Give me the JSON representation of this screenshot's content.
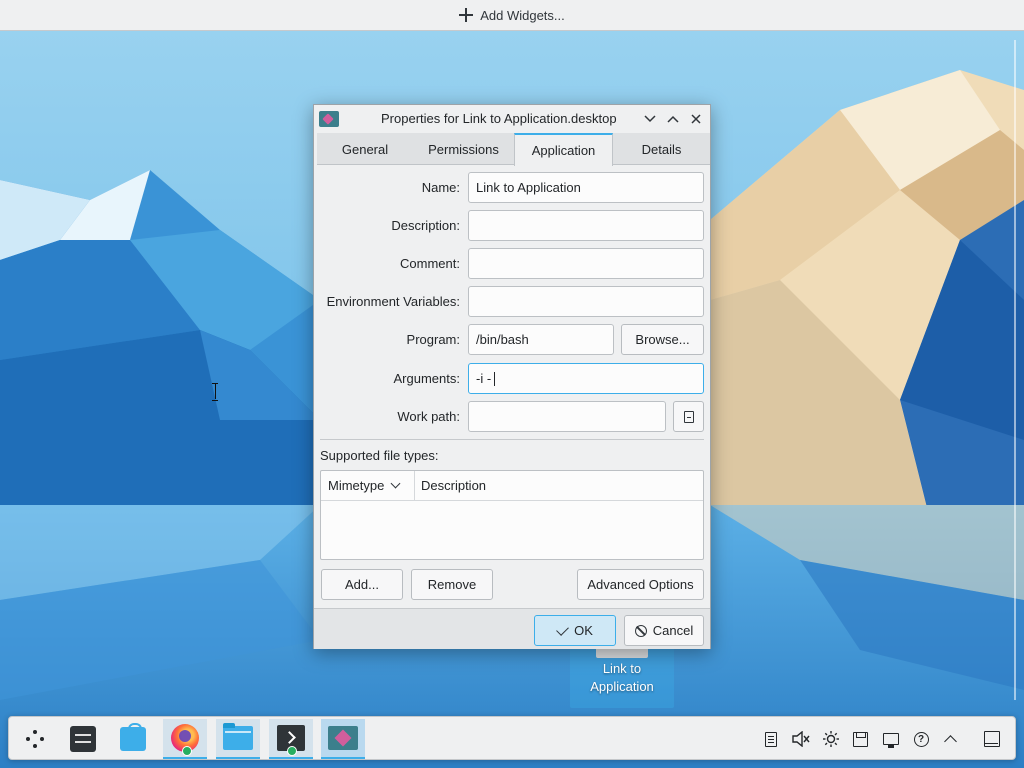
{
  "top_panel": {
    "add_widgets_label": "Add Widgets..."
  },
  "dialog": {
    "title": "Properties for Link to Application.desktop",
    "tabs": [
      {
        "label": "General",
        "active": false
      },
      {
        "label": "Permissions",
        "active": false
      },
      {
        "label": "Application",
        "active": true
      },
      {
        "label": "Details",
        "active": false
      }
    ],
    "fields": {
      "name": {
        "label": "Name:",
        "value": "Link to Application"
      },
      "description": {
        "label": "Description:",
        "value": ""
      },
      "comment": {
        "label": "Comment:",
        "value": ""
      },
      "env_vars": {
        "label": "Environment Variables:",
        "value": ""
      },
      "program": {
        "label": "Program:",
        "value": "/bin/bash"
      },
      "arguments": {
        "label": "Arguments:",
        "value": "-i -"
      },
      "work_path": {
        "label": "Work path:",
        "value": ""
      }
    },
    "browse_label": "Browse...",
    "supported_file_types_label": "Supported file types:",
    "mime_table": {
      "columns": [
        "Mimetype",
        "Description"
      ],
      "rows": []
    },
    "add_label": "Add...",
    "remove_label": "Remove",
    "advanced_label": "Advanced Options",
    "ok_label": "OK",
    "cancel_label": "Cancel"
  },
  "desktop_icon": {
    "label_line1": "Link to",
    "label_line2": "Application"
  },
  "taskbar": {
    "items": [
      {
        "icon": "application-launcher-icon"
      },
      {
        "icon": "system-settings-icon"
      },
      {
        "icon": "discover-icon"
      },
      {
        "icon": "firefox-icon"
      },
      {
        "icon": "dolphin-file-manager-icon"
      },
      {
        "icon": "konsole-icon"
      },
      {
        "icon": "desktop-link-icon"
      }
    ],
    "tray": [
      "clipboard-icon",
      "volume-muted-icon",
      "brightness-icon",
      "disks-icon",
      "network-icon",
      "help-icon",
      "expand-tray-icon",
      "show-desktop-icon"
    ]
  },
  "colors": {
    "accent": "#3daee9",
    "window_bg": "#eff0f1",
    "text": "#232629"
  }
}
